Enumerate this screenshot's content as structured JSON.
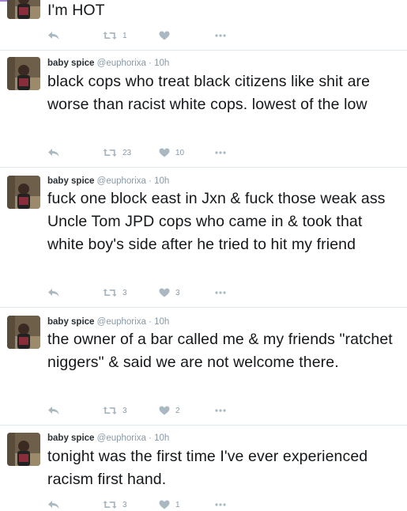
{
  "tweets": [
    {
      "name": "",
      "handle": "",
      "time": "",
      "text": "I'm HOT",
      "replies": "",
      "retweets": "1",
      "likes": ""
    },
    {
      "name": "baby spice",
      "handle": "@euphorixa",
      "time": "· 10h",
      "text": "black cops who treat black citizens like shit are worse than racist white cops. lowest of the low",
      "replies": "",
      "retweets": "23",
      "likes": "10"
    },
    {
      "name": "baby spice",
      "handle": "@euphorixa",
      "time": "· 10h",
      "text": "fuck one block east in Jxn & fuck those weak ass Uncle Tom JPD cops who came in & took that white boy's side after he tried to hit my friend",
      "replies": "",
      "retweets": "3",
      "likes": "3"
    },
    {
      "name": "baby spice",
      "handle": "@euphorixa",
      "time": "· 10h",
      "text": "the owner of a bar called me & my friends \"ratchet niggers\" & said we are not welcome there.",
      "replies": "",
      "retweets": "3",
      "likes": "2"
    },
    {
      "name": "baby spice",
      "handle": "@euphorixa",
      "time": "· 10h",
      "text": "tonight was the first time I've ever experienced racism first hand.",
      "replies": "",
      "retweets": "3",
      "likes": "1"
    }
  ],
  "icons": {
    "reply": "reply-icon",
    "retweet": "retweet-icon",
    "like": "heart-icon",
    "more": "more-dots-icon"
  },
  "colors": {
    "text": "#14171a",
    "meta": "#8899a6",
    "icon": "#aab8c2",
    "divider": "#e1e8ed"
  }
}
